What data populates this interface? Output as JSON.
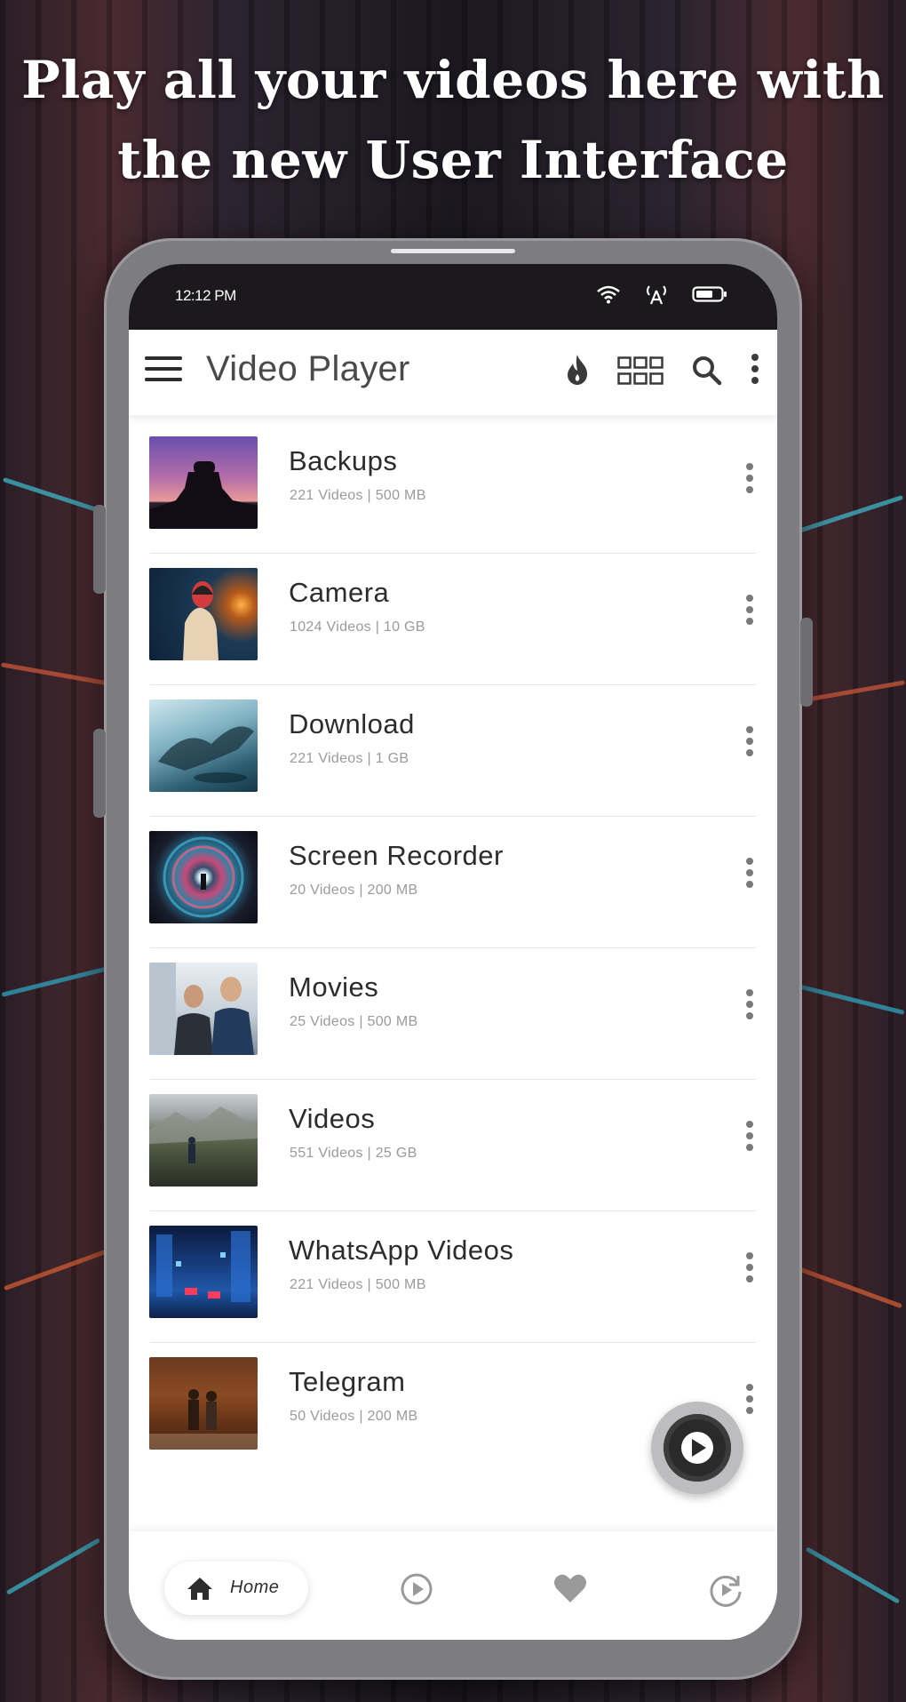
{
  "promo": {
    "headline_line1": "Play all your videos here with",
    "headline_line2": "the new User Interface"
  },
  "status_bar": {
    "time": "12:12 PM",
    "icons": [
      "wifi-icon",
      "antenna-icon",
      "battery-icon"
    ]
  },
  "app_bar": {
    "title": "Video Player",
    "actions": [
      "flame-icon",
      "grid-view-icon",
      "search-icon",
      "more-vertical-icon"
    ]
  },
  "folders": [
    {
      "name": "Backups",
      "meta": "221 Videos | 500 MB"
    },
    {
      "name": "Camera",
      "meta": "1024 Videos | 10 GB"
    },
    {
      "name": "Download",
      "meta": "221 Videos | 1 GB"
    },
    {
      "name": "Screen Recorder",
      "meta": "20 Videos | 200 MB"
    },
    {
      "name": "Movies",
      "meta": "25 Videos | 500 MB"
    },
    {
      "name": "Videos",
      "meta": "551 Videos | 25 GB"
    },
    {
      "name": "WhatsApp Videos",
      "meta": "221 Videos | 500 MB"
    },
    {
      "name": "Telegram",
      "meta": "50 Videos | 200 MB"
    }
  ],
  "fab": {
    "icon": "play-icon"
  },
  "bottom_nav": {
    "home_label": "Home",
    "items": [
      "home-icon",
      "play-circle-icon",
      "heart-icon",
      "refresh-play-icon"
    ],
    "active": "Home"
  },
  "colors": {
    "status_bar_bg": "#1b191c",
    "title_text": "#4a4a4a",
    "meta_text": "#9a9a9a",
    "phone_frame": "#7d7c80"
  }
}
